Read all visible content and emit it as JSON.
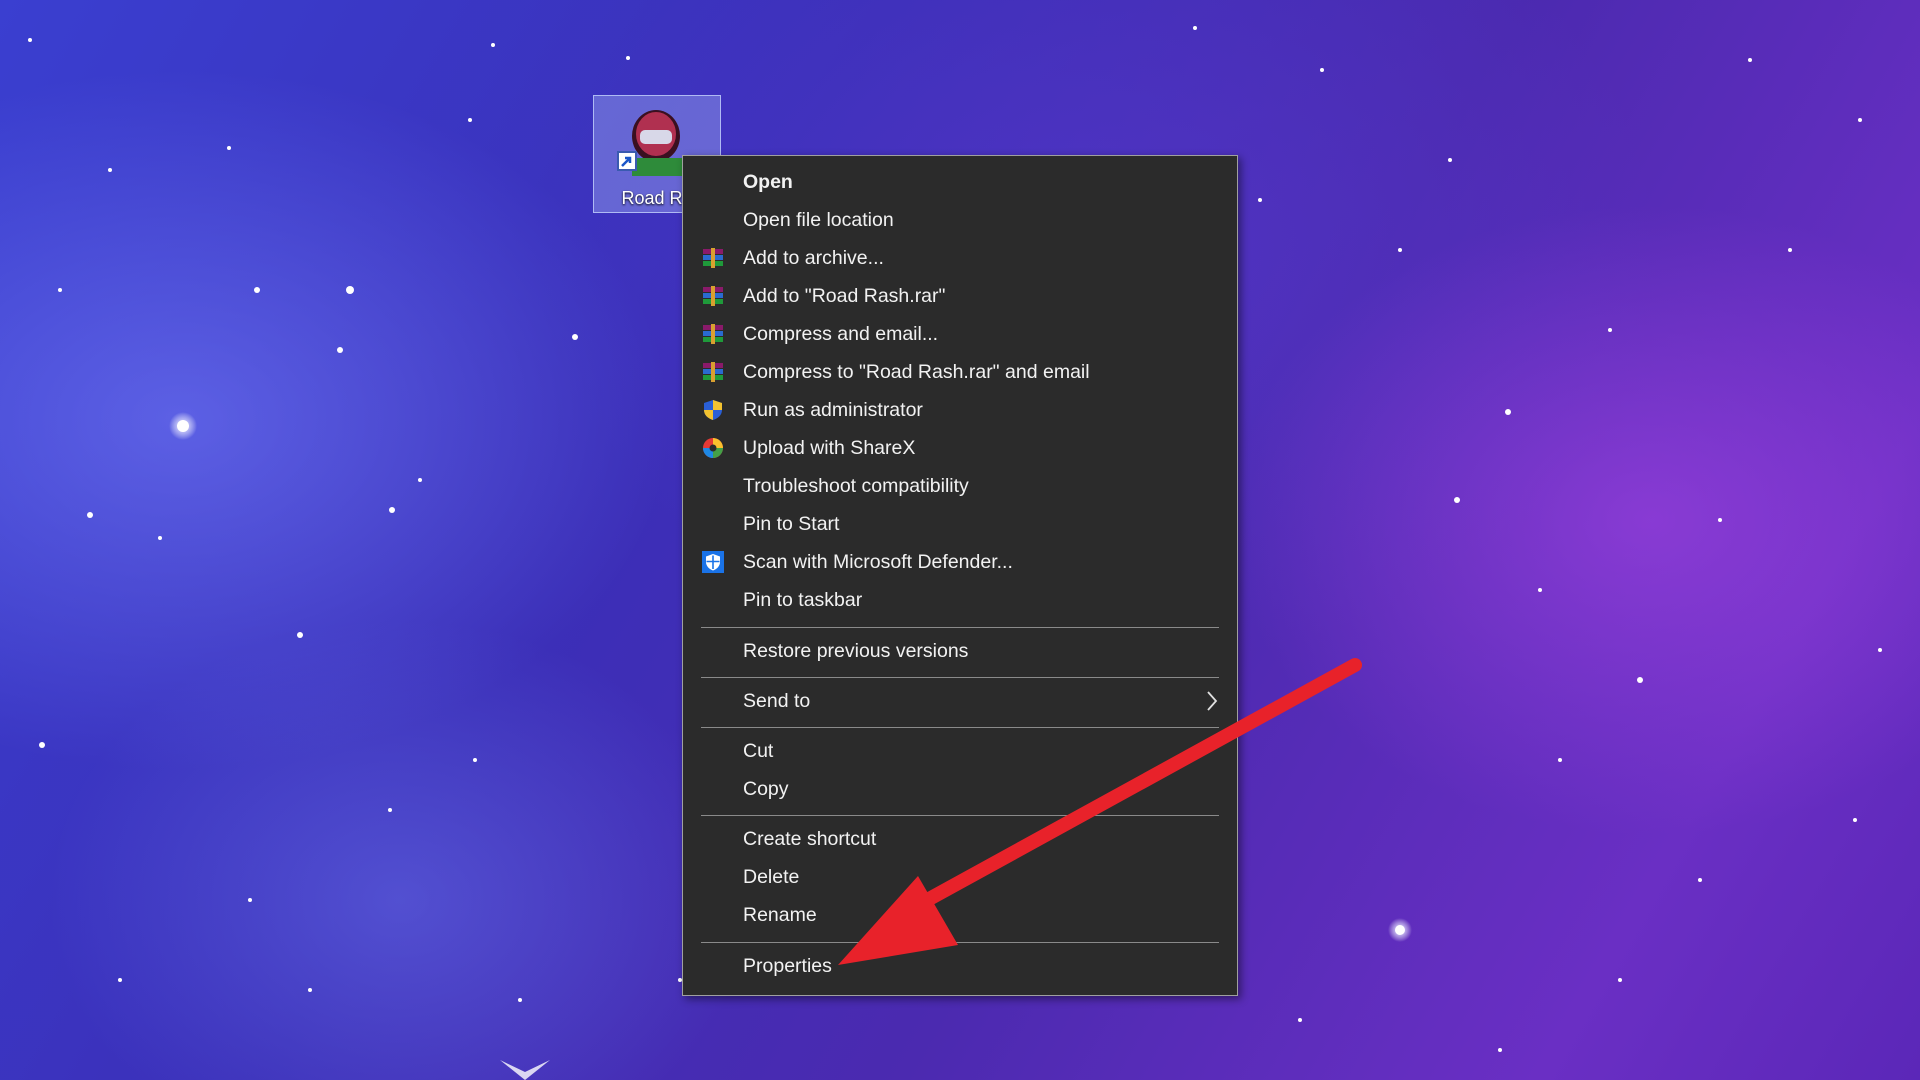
{
  "desktop": {
    "shortcut_label": "Road Ra"
  },
  "context_menu": {
    "items": [
      {
        "label": "Open",
        "icon": ""
      },
      {
        "label": "Open file location",
        "icon": ""
      },
      {
        "label": "Add to archive...",
        "icon": "winrar-icon"
      },
      {
        "label": "Add to \"Road Rash.rar\"",
        "icon": "winrar-icon"
      },
      {
        "label": "Compress and email...",
        "icon": "winrar-icon"
      },
      {
        "label": "Compress to \"Road Rash.rar\" and email",
        "icon": "winrar-icon"
      },
      {
        "label": "Run as administrator",
        "icon": "uac-shield-icon"
      },
      {
        "label": "Upload with ShareX",
        "icon": "sharex-icon"
      },
      {
        "label": "Troubleshoot compatibility",
        "icon": ""
      },
      {
        "label": "Pin to Start",
        "icon": ""
      },
      {
        "label": "Scan with Microsoft Defender...",
        "icon": "defender-icon"
      },
      {
        "label": "Pin to taskbar",
        "icon": ""
      },
      {
        "label": "Restore previous versions",
        "icon": ""
      },
      {
        "label": "Send to",
        "icon": "chevron-right-icon"
      },
      {
        "label": "Cut",
        "icon": ""
      },
      {
        "label": "Copy",
        "icon": ""
      },
      {
        "label": "Create shortcut",
        "icon": ""
      },
      {
        "label": "Delete",
        "icon": ""
      },
      {
        "label": "Rename",
        "icon": ""
      },
      {
        "label": "Properties",
        "icon": ""
      }
    ]
  },
  "colors": {
    "menu_bg": "#2b2b2b",
    "menu_text": "#f2f2f2",
    "arrow": "#e8222a"
  }
}
